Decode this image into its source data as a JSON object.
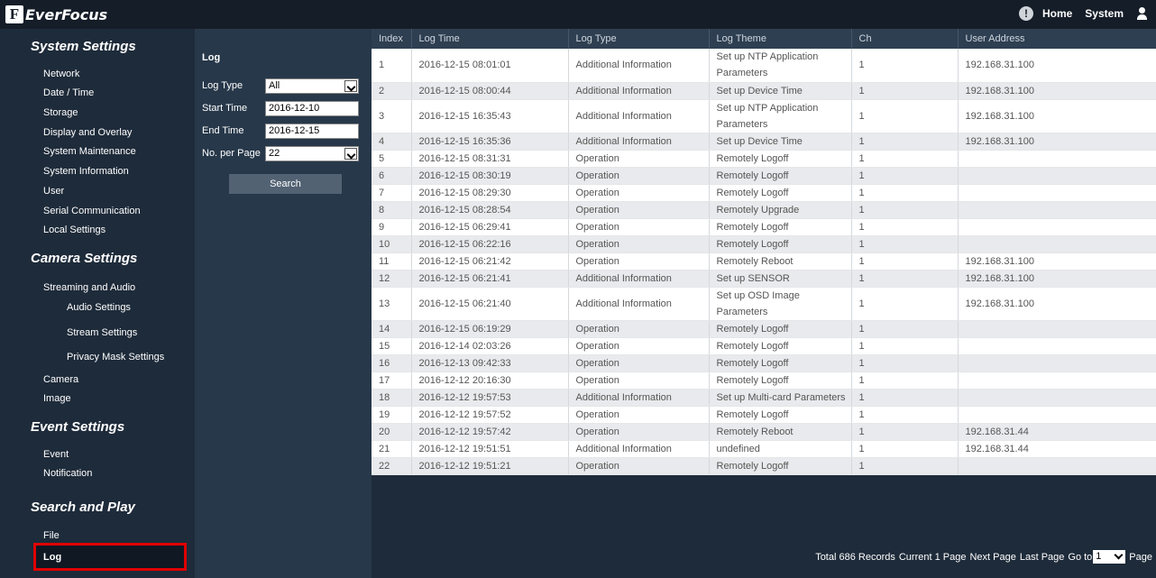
{
  "brand": "EverFocus",
  "topnav": {
    "home": "Home",
    "system": "System"
  },
  "sidebar": {
    "system_settings": "System Settings",
    "system_items": [
      "Network",
      "Date / Time",
      "Storage",
      "Display and Overlay",
      "System Maintenance",
      "System Information",
      "User",
      "Serial Communication",
      "Local Settings"
    ],
    "camera_settings": "Camera Settings",
    "camera_items": [
      "Streaming and Audio",
      "Audio Settings",
      "Stream Settings",
      "Privacy Mask Settings",
      "Camera",
      "Image"
    ],
    "event_settings": "Event Settings",
    "event_items": [
      "Event",
      "Notification"
    ],
    "search_play": "Search and Play",
    "search_items": [
      "File",
      "Log"
    ]
  },
  "filter": {
    "title": "Log",
    "log_type_label": "Log Type",
    "log_type_value": "All",
    "start_label": "Start Time",
    "start_value": "2016-12-10",
    "end_label": "End Time",
    "end_value": "2016-12-15",
    "per_page_label": "No. per Page",
    "per_page_value": "22",
    "search": "Search"
  },
  "table": {
    "headers": [
      "Index",
      "Log Time",
      "Log Type",
      "Log Theme",
      "Ch",
      "User Address"
    ],
    "rows": [
      [
        "1",
        "2016-12-15 08:01:01",
        "Additional Information",
        "Set up NTP Application Parameters",
        "1",
        "192.168.31.100"
      ],
      [
        "2",
        "2016-12-15 08:00:44",
        "Additional Information",
        "Set up Device Time",
        "1",
        "192.168.31.100"
      ],
      [
        "3",
        "2016-12-15 16:35:43",
        "Additional Information",
        "Set up NTP Application Parameters",
        "1",
        "192.168.31.100"
      ],
      [
        "4",
        "2016-12-15 16:35:36",
        "Additional Information",
        "Set up Device Time",
        "1",
        "192.168.31.100"
      ],
      [
        "5",
        "2016-12-15 08:31:31",
        "Operation",
        "Remotely Logoff",
        "1",
        ""
      ],
      [
        "6",
        "2016-12-15 08:30:19",
        "Operation",
        "Remotely Logoff",
        "1",
        ""
      ],
      [
        "7",
        "2016-12-15 08:29:30",
        "Operation",
        "Remotely Logoff",
        "1",
        ""
      ],
      [
        "8",
        "2016-12-15 08:28:54",
        "Operation",
        "Remotely Upgrade",
        "1",
        ""
      ],
      [
        "9",
        "2016-12-15 06:29:41",
        "Operation",
        "Remotely Logoff",
        "1",
        ""
      ],
      [
        "10",
        "2016-12-15 06:22:16",
        "Operation",
        "Remotely Logoff",
        "1",
        ""
      ],
      [
        "11",
        "2016-12-15 06:21:42",
        "Operation",
        "Remotely Reboot",
        "1",
        "192.168.31.100"
      ],
      [
        "12",
        "2016-12-15 06:21:41",
        "Additional Information",
        "Set up SENSOR",
        "1",
        "192.168.31.100"
      ],
      [
        "13",
        "2016-12-15 06:21:40",
        "Additional Information",
        "Set up OSD Image Parameters",
        "1",
        "192.168.31.100"
      ],
      [
        "14",
        "2016-12-15 06:19:29",
        "Operation",
        "Remotely Logoff",
        "1",
        ""
      ],
      [
        "15",
        "2016-12-14 02:03:26",
        "Operation",
        "Remotely Logoff",
        "1",
        ""
      ],
      [
        "16",
        "2016-12-13 09:42:33",
        "Operation",
        "Remotely Logoff",
        "1",
        ""
      ],
      [
        "17",
        "2016-12-12 20:16:30",
        "Operation",
        "Remotely Logoff",
        "1",
        ""
      ],
      [
        "18",
        "2016-12-12 19:57:53",
        "Additional Information",
        "Set up Multi-card Parameters",
        "1",
        ""
      ],
      [
        "19",
        "2016-12-12 19:57:52",
        "Operation",
        "Remotely Logoff",
        "1",
        ""
      ],
      [
        "20",
        "2016-12-12 19:57:42",
        "Operation",
        "Remotely Reboot",
        "1",
        "192.168.31.44"
      ],
      [
        "21",
        "2016-12-12 19:51:51",
        "Additional Information",
        "undefined",
        "1",
        "192.168.31.44"
      ],
      [
        "22",
        "2016-12-12 19:51:21",
        "Operation",
        "Remotely Logoff",
        "1",
        ""
      ]
    ]
  },
  "pager": {
    "total": "Total 686 Records",
    "current": "Current 1 Page",
    "next": "Next Page",
    "last": "Last Page",
    "goto": "Go to",
    "goto_value": "1",
    "page": "Page"
  }
}
